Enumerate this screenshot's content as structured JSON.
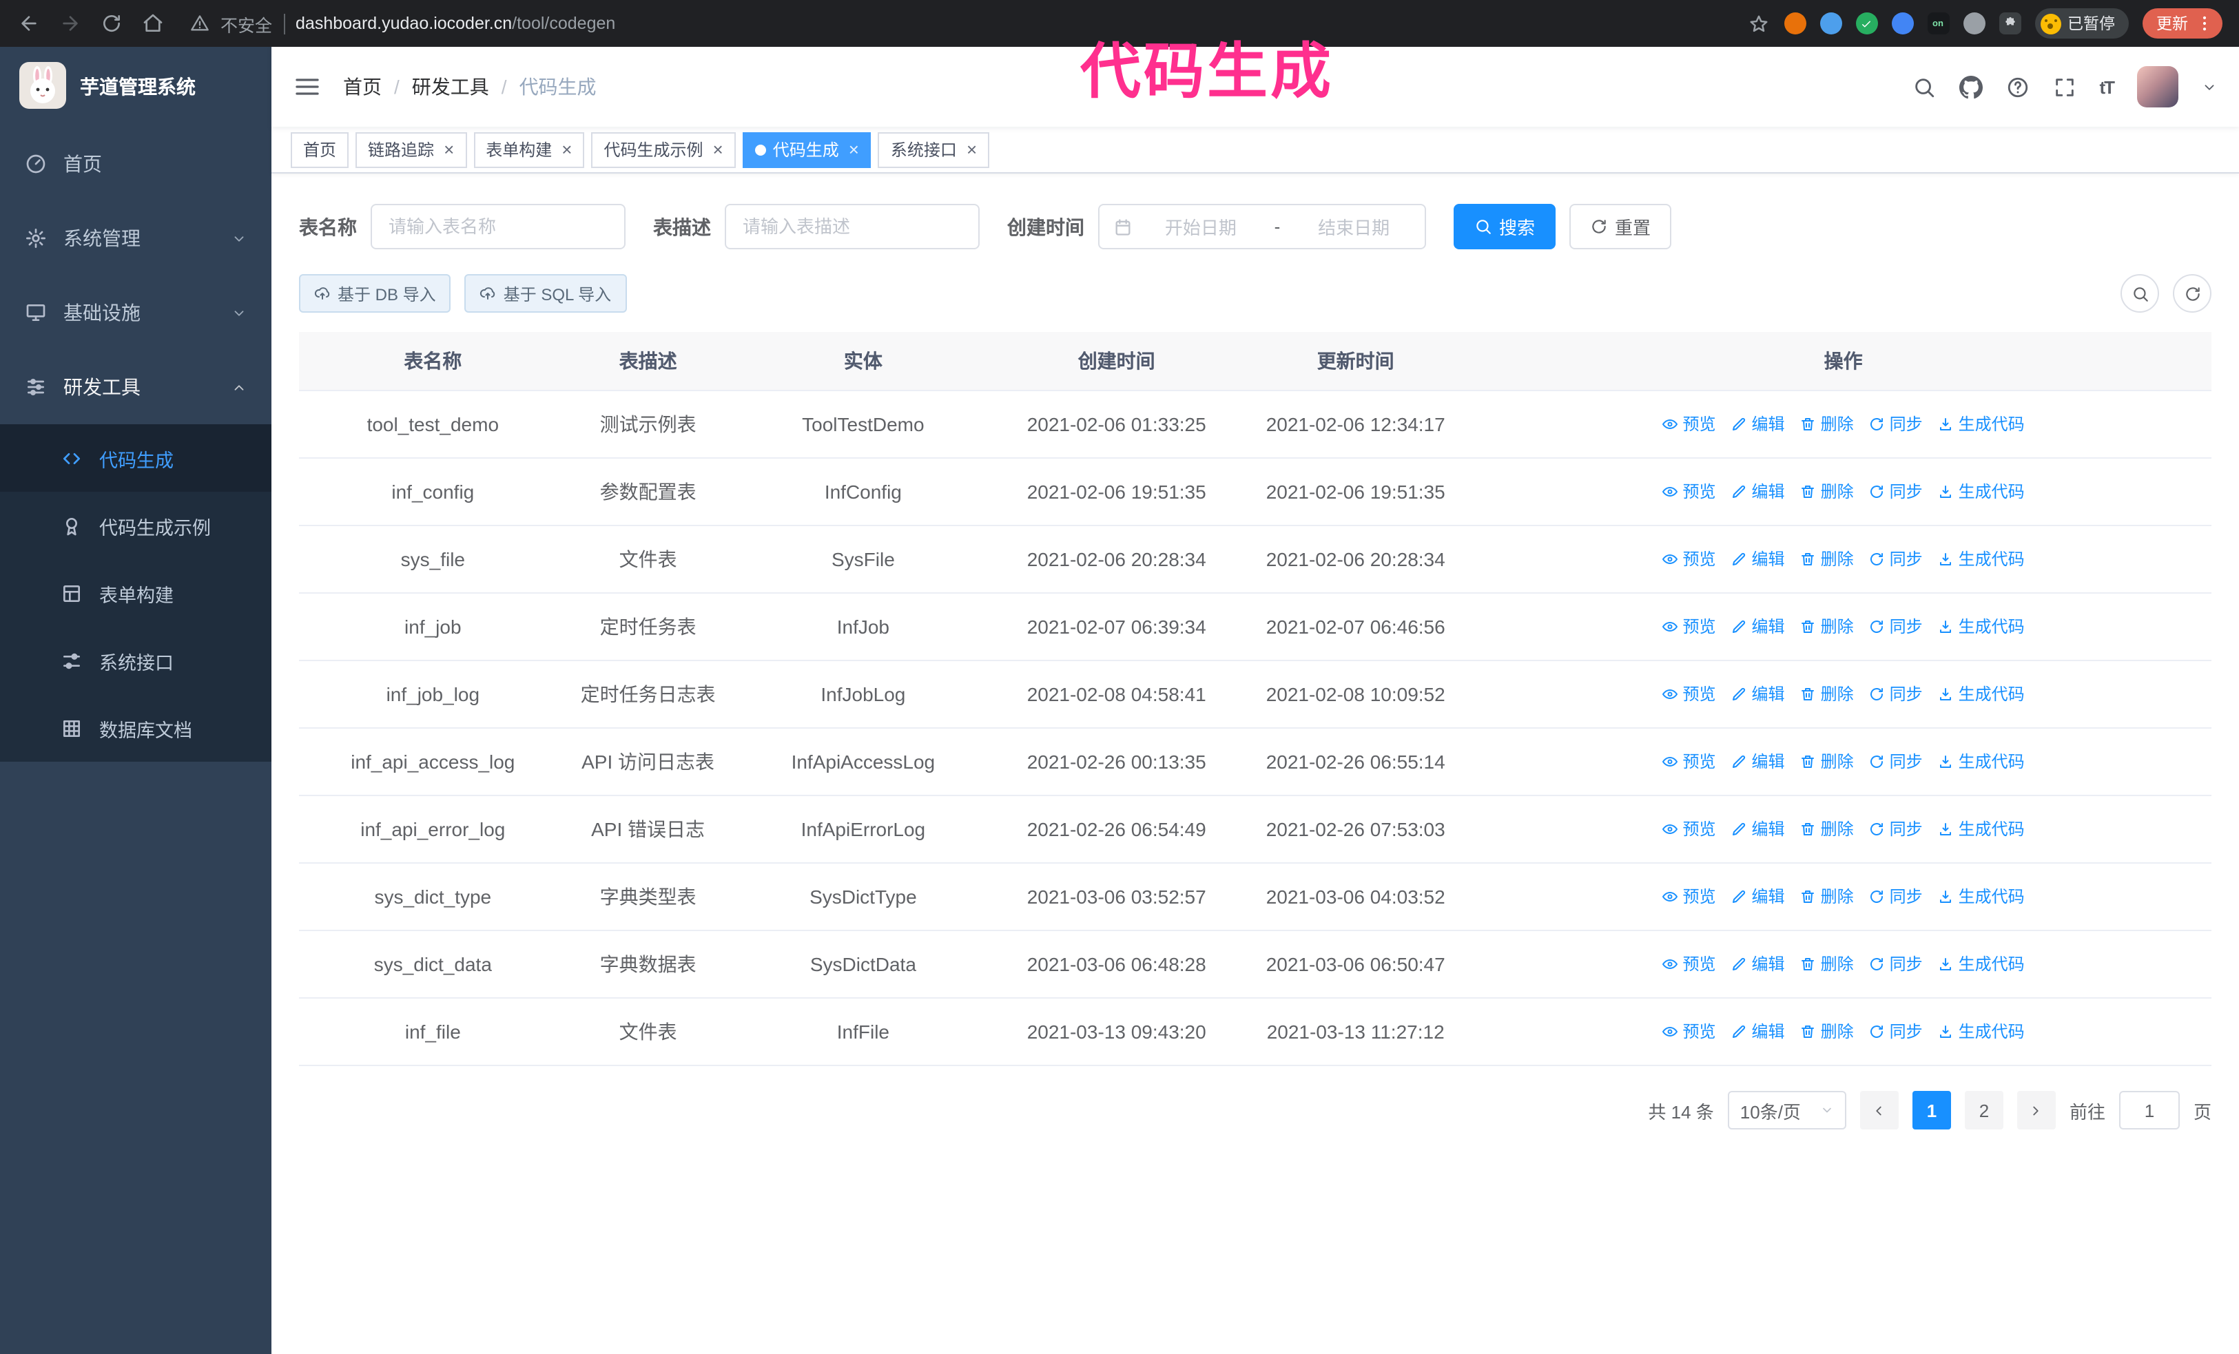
{
  "colors": {
    "accent_blue": "#409eff",
    "link_blue": "#1890ff",
    "sidebar_bg": "#304156",
    "submenu_bg": "#1f2d3d",
    "annotation_pink": "#ff2f8e",
    "chrome_bg": "#202124",
    "update_chip_red": "#e0614f"
  },
  "browser": {
    "security_warning": "不安全",
    "url_host": "dashboard.yudao.iocoder.cn",
    "url_path": "/tool/codegen",
    "paused_chip": "已暂停",
    "update_chip": "更新"
  },
  "annotation": {
    "text": "代码生成"
  },
  "sidebar": {
    "title": "芋道管理系统",
    "items": [
      {
        "label": "首页"
      },
      {
        "label": "系统管理"
      },
      {
        "label": "基础设施"
      },
      {
        "label": "研发工具"
      }
    ],
    "submenu": [
      {
        "label": "代码生成"
      },
      {
        "label": "代码生成示例"
      },
      {
        "label": "表单构建"
      },
      {
        "label": "系统接口"
      },
      {
        "label": "数据库文档"
      }
    ]
  },
  "header": {
    "breadcrumb": [
      "首页",
      "研发工具",
      "代码生成"
    ],
    "font_size_tool": "tT"
  },
  "tabs": [
    {
      "label": "首页",
      "closable": false,
      "active": false
    },
    {
      "label": "链路追踪",
      "closable": true,
      "active": false
    },
    {
      "label": "表单构建",
      "closable": true,
      "active": false
    },
    {
      "label": "代码生成示例",
      "closable": true,
      "active": false
    },
    {
      "label": "代码生成",
      "closable": true,
      "active": true
    },
    {
      "label": "系统接口",
      "closable": true,
      "active": false
    }
  ],
  "filters": {
    "name_label": "表名称",
    "name_placeholder": "请输入表名称",
    "desc_label": "表描述",
    "desc_placeholder": "请输入表描述",
    "time_label": "创建时间",
    "start_placeholder": "开始日期",
    "range_separator": "-",
    "end_placeholder": "结束日期",
    "search_button": "搜索",
    "reset_button": "重置"
  },
  "toolbar": {
    "import_db": "基于 DB 导入",
    "import_sql": "基于 SQL 导入"
  },
  "table": {
    "columns": [
      "表名称",
      "表描述",
      "实体",
      "创建时间",
      "更新时间",
      "操作"
    ],
    "actions": [
      "预览",
      "编辑",
      "删除",
      "同步",
      "生成代码"
    ],
    "rows": [
      {
        "name": "tool_test_demo",
        "desc": "测试示例表",
        "entity": "ToolTestDemo",
        "created": "2021-02-06 01:33:25",
        "updated": "2021-02-06 12:34:17"
      },
      {
        "name": "inf_config",
        "desc": "参数配置表",
        "entity": "InfConfig",
        "created": "2021-02-06 19:51:35",
        "updated": "2021-02-06 19:51:35"
      },
      {
        "name": "sys_file",
        "desc": "文件表",
        "entity": "SysFile",
        "created": "2021-02-06 20:28:34",
        "updated": "2021-02-06 20:28:34"
      },
      {
        "name": "inf_job",
        "desc": "定时任务表",
        "entity": "InfJob",
        "created": "2021-02-07 06:39:34",
        "updated": "2021-02-07 06:46:56"
      },
      {
        "name": "inf_job_log",
        "desc": "定时任务日志表",
        "entity": "InfJobLog",
        "created": "2021-02-08 04:58:41",
        "updated": "2021-02-08 10:09:52"
      },
      {
        "name": "inf_api_access_log",
        "desc": "API 访问日志表",
        "entity": "InfApiAccessLog",
        "created": "2021-02-26 00:13:35",
        "updated": "2021-02-26 06:55:14"
      },
      {
        "name": "inf_api_error_log",
        "desc": "API 错误日志",
        "entity": "InfApiErrorLog",
        "created": "2021-02-26 06:54:49",
        "updated": "2021-02-26 07:53:03"
      },
      {
        "name": "sys_dict_type",
        "desc": "字典类型表",
        "entity": "SysDictType",
        "created": "2021-03-06 03:52:57",
        "updated": "2021-03-06 04:03:52"
      },
      {
        "name": "sys_dict_data",
        "desc": "字典数据表",
        "entity": "SysDictData",
        "created": "2021-03-06 06:48:28",
        "updated": "2021-03-06 06:50:47"
      },
      {
        "name": "inf_file",
        "desc": "文件表",
        "entity": "InfFile",
        "created": "2021-03-13 09:43:20",
        "updated": "2021-03-13 11:27:12"
      }
    ]
  },
  "pagination": {
    "total": "共 14 条",
    "page_size": "10条/页",
    "pages": [
      "1",
      "2"
    ],
    "active_page": "1",
    "goto_label": "前往",
    "goto_value": "1",
    "goto_suffix": "页"
  },
  "icons": {
    "row_actions": [
      "eye-icon",
      "edit-icon",
      "trash-icon",
      "sync-icon",
      "download-icon"
    ]
  }
}
